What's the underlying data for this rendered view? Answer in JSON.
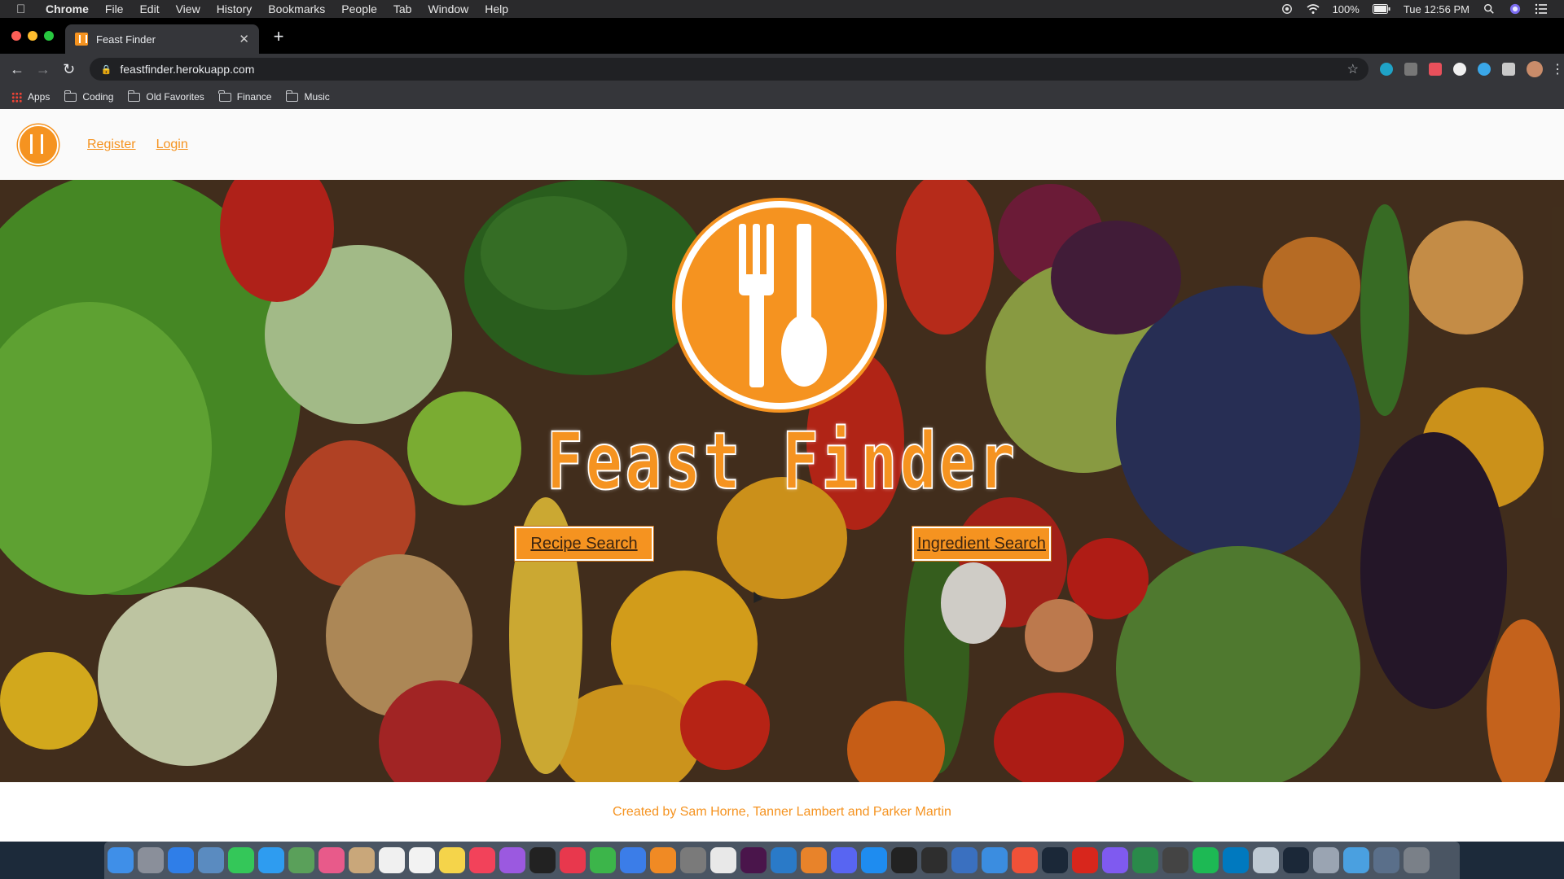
{
  "menubar": {
    "app_name": "Chrome",
    "items": [
      "File",
      "Edit",
      "View",
      "History",
      "Bookmarks",
      "People",
      "Tab",
      "Window",
      "Help"
    ],
    "battery": "100%",
    "clock": "Tue 12:56 PM"
  },
  "browser": {
    "tab_title": "Feast Finder",
    "url": "feastfinder.herokuapp.com",
    "bookmarks": [
      "Apps",
      "Coding",
      "Old Favorites",
      "Finance",
      "Music"
    ]
  },
  "site": {
    "nav": {
      "register": "Register",
      "login": "Login"
    },
    "hero": {
      "title": "Feast Finder",
      "recipe_button": "Recipe Search",
      "ingredient_button": "Ingredient Search"
    },
    "footer": "Created by Sam Horne, Tanner Lambert and Parker Martin",
    "brand_color": "#f59320"
  },
  "dock": {
    "icons": [
      "finder-icon",
      "launchpad-icon",
      "safari-icon",
      "preview-icon",
      "facetime-icon",
      "messages-icon",
      "maps-icon",
      "photos-icon",
      "contacts-icon",
      "calendar-icon",
      "reminders-icon",
      "notes-icon",
      "music-icon",
      "podcasts-icon",
      "tv-icon",
      "news-icon",
      "numbers-icon",
      "keynote-icon",
      "pages-icon",
      "system-preferences-icon",
      "chrome-icon",
      "slack-icon",
      "vscode-icon",
      "books-icon",
      "discord-icon",
      "app-store-icon",
      "terminal-icon",
      "activity-monitor-icon",
      "network-icon",
      "xcode-icon",
      "swift-icon",
      "steam-icon",
      "acrobat-icon",
      "imovie-icon",
      "sourcetree-icon",
      "drive-icon",
      "spotify-icon",
      "trello-icon",
      "quicktime-icon",
      "steam-2-icon",
      "screenshot-icon",
      "downloads-icon",
      "folder-icon",
      "trash-icon"
    ]
  }
}
